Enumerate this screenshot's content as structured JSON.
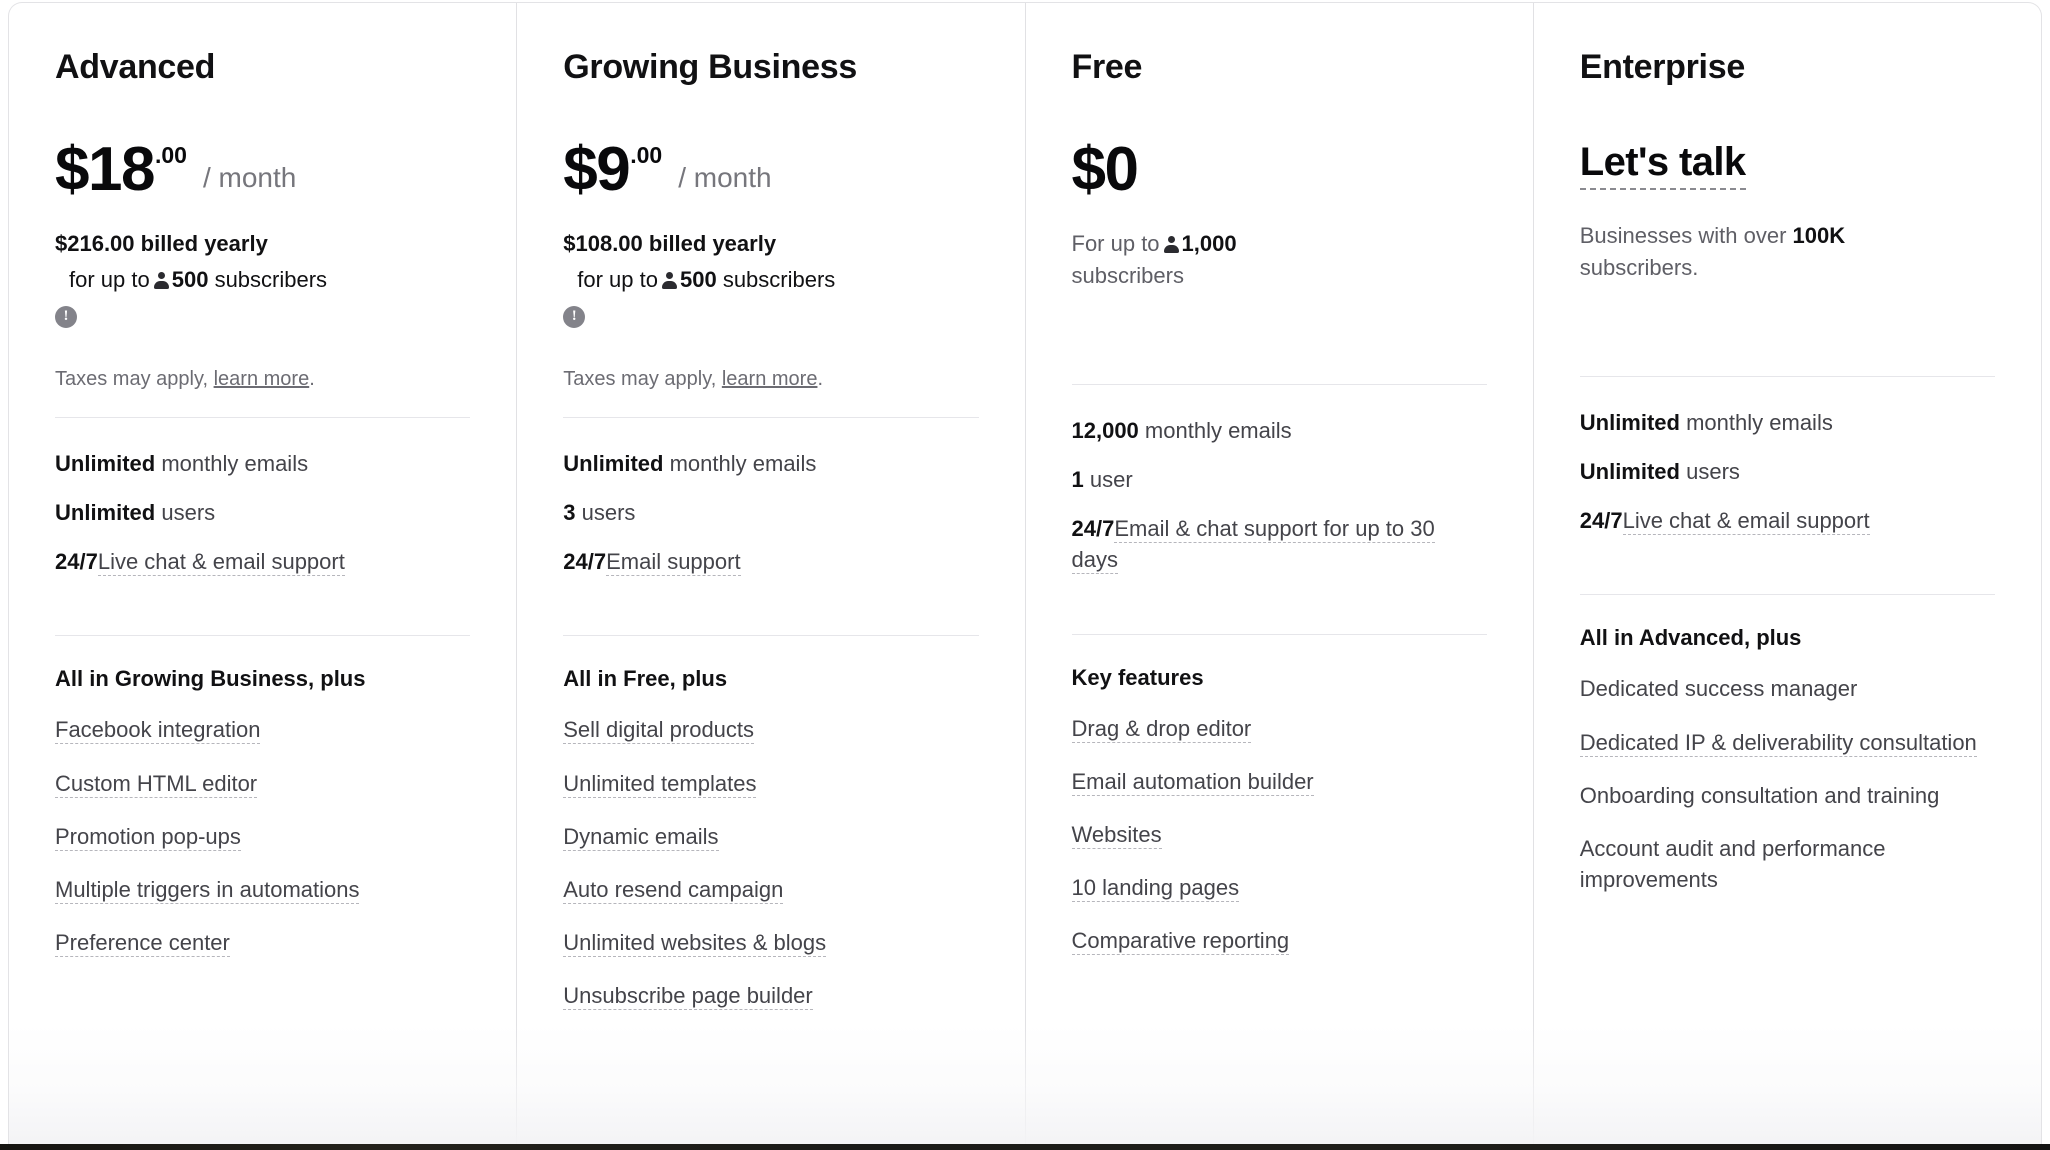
{
  "colors": {
    "text_primary": "#111113",
    "text_secondary": "#44444a",
    "text_muted": "#6c6c73",
    "border": "#e1e1e4",
    "info_badge": "#83838a"
  },
  "plans": [
    {
      "name": "Advanced",
      "price_amount": "$18",
      "price_cents": ".00",
      "price_period": "/ month",
      "billing_line": "$216.00 billed yearly",
      "billing_sub_prefix": "for up to",
      "billing_sub_count": "500",
      "billing_sub_suffix": "subscribers",
      "info_badge": "!",
      "taxes_prefix": "Taxes may apply,",
      "taxes_link": "learn more",
      "taxes_suffix": ".",
      "core_features": [
        {
          "qty": "Unlimited",
          "text": "monthly emails",
          "tooltip": false
        },
        {
          "qty": "Unlimited",
          "text": "users",
          "tooltip": false
        },
        {
          "qty": "24/7",
          "text": "Live chat & email support",
          "tooltip": true
        }
      ],
      "features_heading": "All in Growing Business, plus",
      "features": [
        {
          "text": "Facebook integration",
          "tooltip": true
        },
        {
          "text": "Custom HTML editor",
          "tooltip": true
        },
        {
          "text": "Promotion pop-ups",
          "tooltip": true
        },
        {
          "text": "Multiple triggers in automations",
          "tooltip": true
        },
        {
          "text": "Preference center",
          "tooltip": true
        }
      ]
    },
    {
      "name": "Growing Business",
      "price_amount": "$9",
      "price_cents": ".00",
      "price_period": "/ month",
      "billing_line": "$108.00 billed yearly",
      "billing_sub_prefix": "for up to",
      "billing_sub_count": "500",
      "billing_sub_suffix": "subscribers",
      "info_badge": "!",
      "taxes_prefix": "Taxes may apply,",
      "taxes_link": "learn more",
      "taxes_suffix": ".",
      "core_features": [
        {
          "qty": "Unlimited",
          "text": "monthly emails",
          "tooltip": false
        },
        {
          "qty": "3",
          "text": "users",
          "tooltip": false
        },
        {
          "qty": "24/7",
          "text": "Email support",
          "tooltip": true
        }
      ],
      "features_heading": "All in Free, plus",
      "features": [
        {
          "text": "Sell digital products",
          "tooltip": true
        },
        {
          "text": "Unlimited templates",
          "tooltip": true
        },
        {
          "text": "Dynamic emails",
          "tooltip": true
        },
        {
          "text": "Auto resend campaign",
          "tooltip": true
        },
        {
          "text": "Unlimited websites & blogs",
          "tooltip": true
        },
        {
          "text": "Unsubscribe page builder",
          "tooltip": true
        }
      ]
    },
    {
      "name": "Free",
      "price_amount": "$0",
      "price_cents": "",
      "price_period": "",
      "free_prefix": "For up to",
      "free_count": "1,000",
      "free_suffix": "subscribers",
      "core_features": [
        {
          "qty": "12,000",
          "text": "monthly emails",
          "tooltip": false
        },
        {
          "qty": "1",
          "text": "user",
          "tooltip": false
        },
        {
          "qty": "24/7",
          "text": "Email & chat support for up to 30 days",
          "tooltip": true
        }
      ],
      "features_heading": "Key features",
      "features": [
        {
          "text": "Drag & drop editor",
          "tooltip": true
        },
        {
          "text": "Email automation builder",
          "tooltip": true
        },
        {
          "text": "Websites",
          "tooltip": true
        },
        {
          "text": "10 landing pages",
          "tooltip": true
        },
        {
          "text": "Comparative reporting",
          "tooltip": true
        }
      ]
    },
    {
      "name": "Enterprise",
      "price_amount": "Let's talk",
      "ent_prefix": "Businesses with over",
      "ent_count": "100K",
      "ent_suffix": "subscribers.",
      "core_features": [
        {
          "qty": "Unlimited",
          "text": "monthly emails",
          "tooltip": false
        },
        {
          "qty": "Unlimited",
          "text": "users",
          "tooltip": false
        },
        {
          "qty": "24/7",
          "text": "Live chat & email support",
          "tooltip": true
        }
      ],
      "features_heading": "All in Advanced, plus",
      "features": [
        {
          "text": "Dedicated success manager",
          "tooltip": false
        },
        {
          "text": "Dedicated IP & deliverability consultation",
          "tooltip": true
        },
        {
          "text": "Onboarding consultation and training",
          "tooltip": false
        },
        {
          "text": "Account audit and performance improvements",
          "tooltip": false
        }
      ]
    }
  ]
}
